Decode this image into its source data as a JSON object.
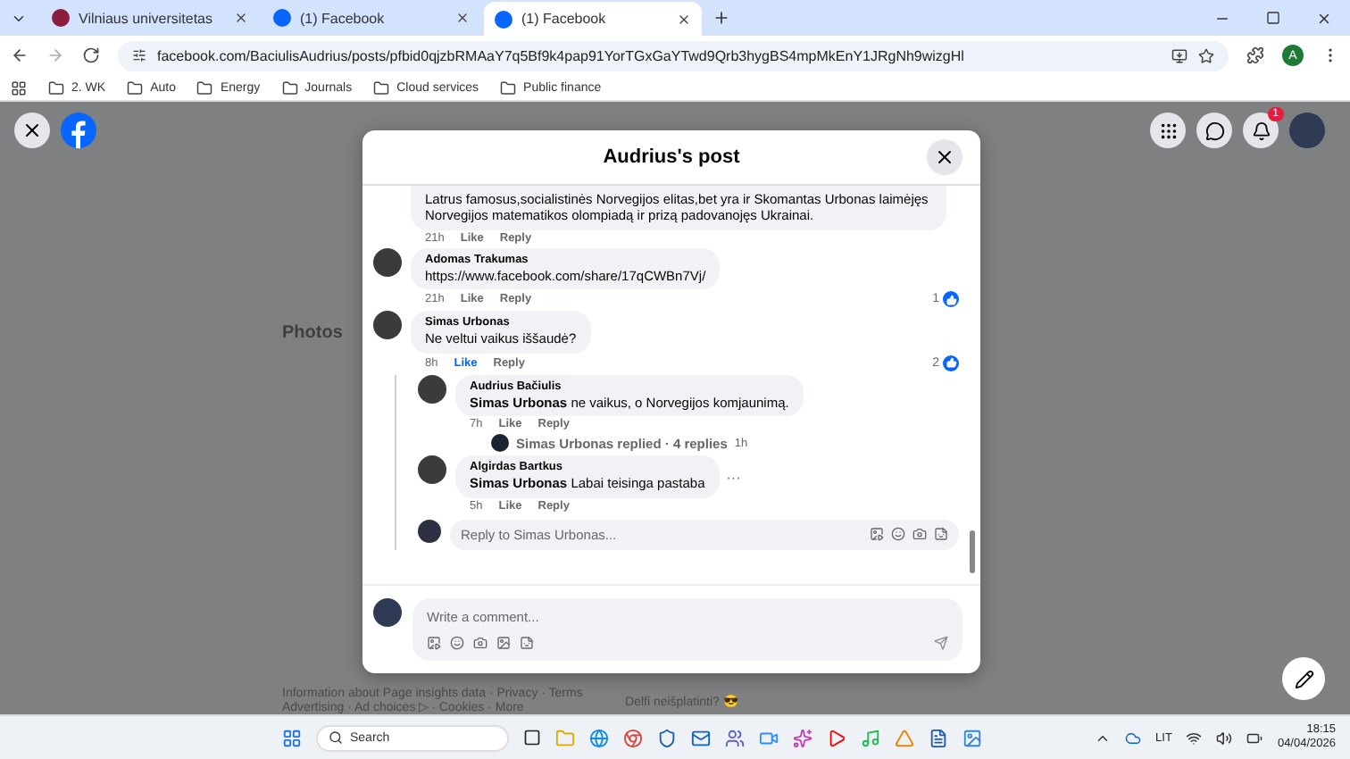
{
  "browser": {
    "tabs": [
      {
        "title": "Vilniaus universitetas",
        "selected": false,
        "kind": "university"
      },
      {
        "title": "(1) Facebook",
        "selected": false,
        "kind": "facebook"
      },
      {
        "title": "(1) Facebook",
        "selected": true,
        "kind": "facebook"
      }
    ],
    "url": "facebook.com/BaciulisAudrius/posts/pfbid0qjzbRMAaY7q5Bf9k4pap91YorTGxGaYTwd9Qrb3hygBS4mpMkEnY1JRgNh9wizgHl",
    "profile_initial": "A",
    "bookmarks": [
      "2. WK",
      "Auto",
      "Energy",
      "Journals",
      "Cloud services",
      "Public finance"
    ]
  },
  "header": {
    "notification_count": "1"
  },
  "background": {
    "photos_heading": "Photos",
    "footer": [
      "Information about Page insights data · Privacy · Terms",
      "Advertising · Ad choices ▷ · Cookies · More"
    ],
    "post_text": "Delfi neišplatinti? 😎"
  },
  "dialog": {
    "title": "Audrius's post",
    "comments": [
      {
        "text": "Latrus famosus,socialistinės Norvegijos elitas,bet yra ir Skomantas Urbonas laimėjęs Norvegijos matematikos olompiadą ir prizą padovanojęs Ukrainai.",
        "time": "21h",
        "like": "Like",
        "reply": "Reply",
        "liked": false
      },
      {
        "author": "Adomas Trakumas",
        "text": "https://www.facebook.com/share/17qCWBn7Vj/",
        "time": "21h",
        "like": "Like",
        "reply": "Reply",
        "liked": false,
        "reactions": "1"
      },
      {
        "author": "Simas Urbonas",
        "text": "Ne veltui vaikus iššaudė?",
        "time": "8h",
        "like": "Like",
        "reply": "Reply",
        "liked": true,
        "reactions": "2",
        "replies": [
          {
            "author": "Audrius Bačiulis",
            "text": "**Simas Urbonas** ne vaikus, o Norvegijos komjaunimą.",
            "time": "7h",
            "like": "Like",
            "reply": "Reply",
            "liked": false,
            "more": {
              "text": "Simas Urbonas replied · 4 replies",
              "time": "1h"
            }
          },
          {
            "author": "Algirdas Bartkus",
            "text": "**Simas Urbonas** Labai teisinga pastaba",
            "time": "5h",
            "like": "Like",
            "reply": "Reply",
            "liked": false,
            "menu": "···"
          }
        ],
        "reply_placeholder": "Reply to Simas Urbonas..."
      }
    ],
    "write_placeholder": "Write a comment..."
  },
  "taskbar": {
    "search": "Search",
    "language": "LIT",
    "time": "18:15",
    "date": "04/04/2026"
  }
}
